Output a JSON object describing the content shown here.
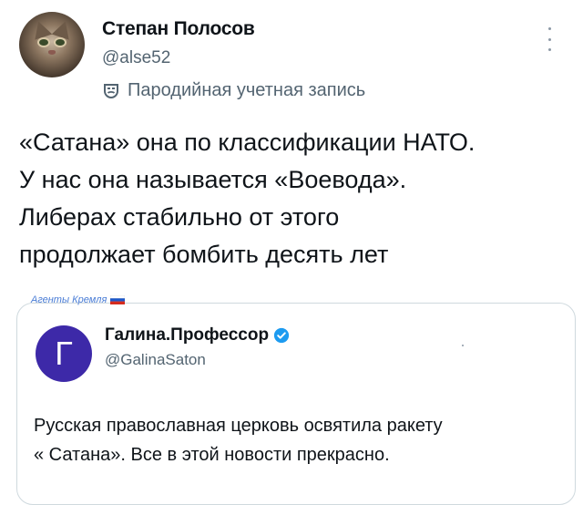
{
  "author": {
    "display_name": "Степан Полосов",
    "handle": "@alse52",
    "parody_label": "Пародийная учетная запись",
    "avatar_icon": "cat-avatar"
  },
  "tweet": {
    "lines": [
      "«Сатана» она по классификации НАТО.",
      "У нас она называется «Воевода».",
      "Либерах стабильно от этого",
      "продолжает бомбить десять лет"
    ]
  },
  "community": {
    "label": "Агенты Кремля",
    "flag_icon": "russia-flag-icon"
  },
  "quoted": {
    "avatar_letter": "Г",
    "avatar_color": "#3d29a8",
    "display_name": "Галина.Профессор",
    "handle": "@GalinaSaton",
    "verified_color": "#1d9bf0",
    "lines": [
      "Русская православная церковь освятила ракету",
      "« Сатана». Все в этой новости прекрасно."
    ]
  }
}
